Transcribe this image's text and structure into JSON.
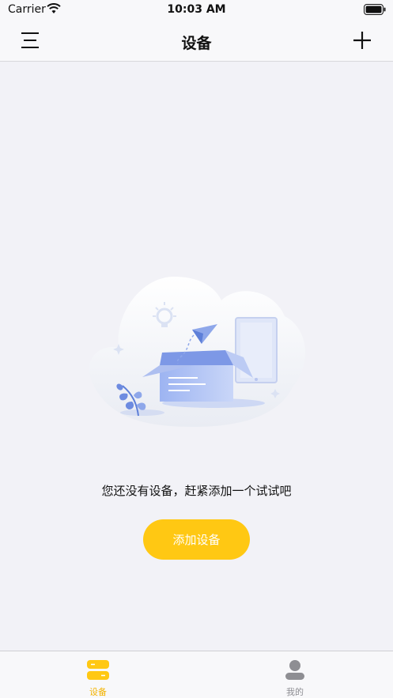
{
  "status_bar": {
    "carrier": "Carrier",
    "time": "10:03 AM"
  },
  "header": {
    "title": "设备"
  },
  "icons": {
    "menu": "menu-icon",
    "add": "plus-icon",
    "devices_tab": "device-stack-icon",
    "mine_tab": "person-icon",
    "illustration": "empty-box-illustration"
  },
  "empty_state": {
    "message": "您还没有设备，赶紧添加一个试试吧",
    "button_label": "添加设备"
  },
  "tabs": [
    {
      "label": "设备",
      "active": true
    },
    {
      "label": "我的",
      "active": false
    }
  ],
  "colors": {
    "accent": "#ffc813",
    "active_tab": "#f3b300",
    "inactive_tab": "#8e8e93",
    "background": "#f2f2f7"
  }
}
